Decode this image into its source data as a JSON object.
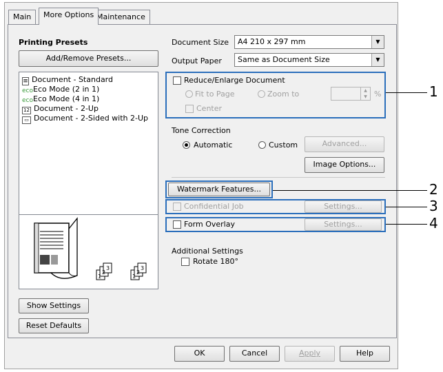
{
  "tabs": [
    "Main",
    "More Options",
    "Maintenance"
  ],
  "presets": {
    "heading": "Printing Presets",
    "add_remove": "Add/Remove Presets...",
    "items": [
      {
        "label": "Document - Standard",
        "icon": "document-icon"
      },
      {
        "label": "Eco Mode (2 in 1)",
        "icon": "eco-icon"
      },
      {
        "label": "Eco Mode (4 in 1)",
        "icon": "eco-icon"
      },
      {
        "label": "Document - 2-Up",
        "icon": "two-up-icon"
      },
      {
        "label": "Document - 2-Sided with 2-Up",
        "icon": "two-sided-icon"
      }
    ]
  },
  "left_buttons": {
    "show_settings": "Show Settings",
    "reset_defaults": "Reset Defaults"
  },
  "document_size": {
    "label": "Document Size",
    "value": "A4 210 x 297 mm"
  },
  "output_paper": {
    "label": "Output Paper",
    "value": "Same as Document Size"
  },
  "reduce": {
    "label": "Reduce/Enlarge Document",
    "fit_to_page": "Fit to Page",
    "zoom_to": "Zoom to",
    "center": "Center",
    "percent": "%"
  },
  "tone": {
    "label": "Tone Correction",
    "automatic": "Automatic",
    "custom": "Custom",
    "advanced": "Advanced...",
    "image_options": "Image Options..."
  },
  "watermark": "Watermark Features...",
  "confidential": {
    "label": "Confidential Job",
    "settings": "Settings..."
  },
  "form_overlay": {
    "label": "Form Overlay",
    "settings": "Settings..."
  },
  "additional": {
    "label": "Additional Settings",
    "rotate": "Rotate 180°"
  },
  "bottom": {
    "ok": "OK",
    "cancel": "Cancel",
    "apply": "Apply",
    "help": "Help"
  },
  "callouts": [
    "1",
    "2",
    "3",
    "4"
  ],
  "colors": {
    "callout": "#2a6ebb",
    "eco_green": "#3a9a3a"
  }
}
